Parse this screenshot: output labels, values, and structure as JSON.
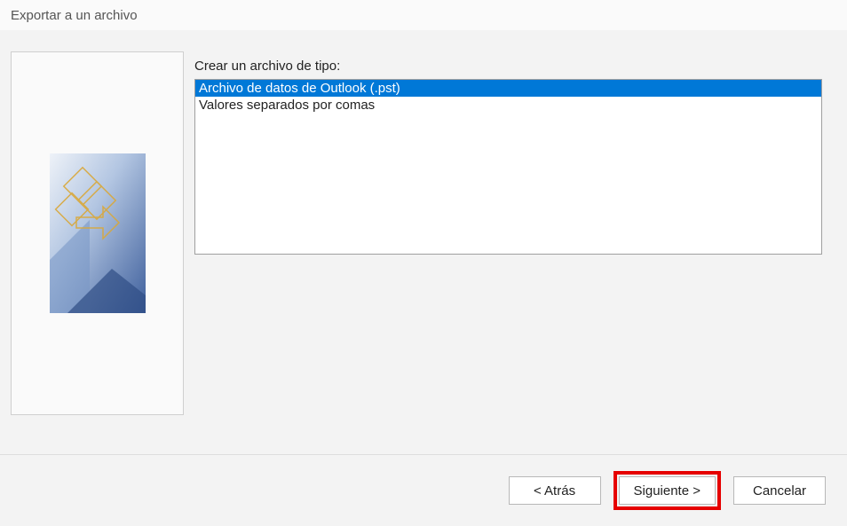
{
  "window": {
    "title": "Exportar a un archivo"
  },
  "content": {
    "prompt": "Crear un archivo de tipo:",
    "options": [
      {
        "label": "Archivo de datos de Outlook (.pst)",
        "selected": true
      },
      {
        "label": "Valores separados por comas",
        "selected": false
      }
    ]
  },
  "buttons": {
    "back": "< Atrás",
    "next": "Siguiente >",
    "cancel": "Cancelar"
  }
}
